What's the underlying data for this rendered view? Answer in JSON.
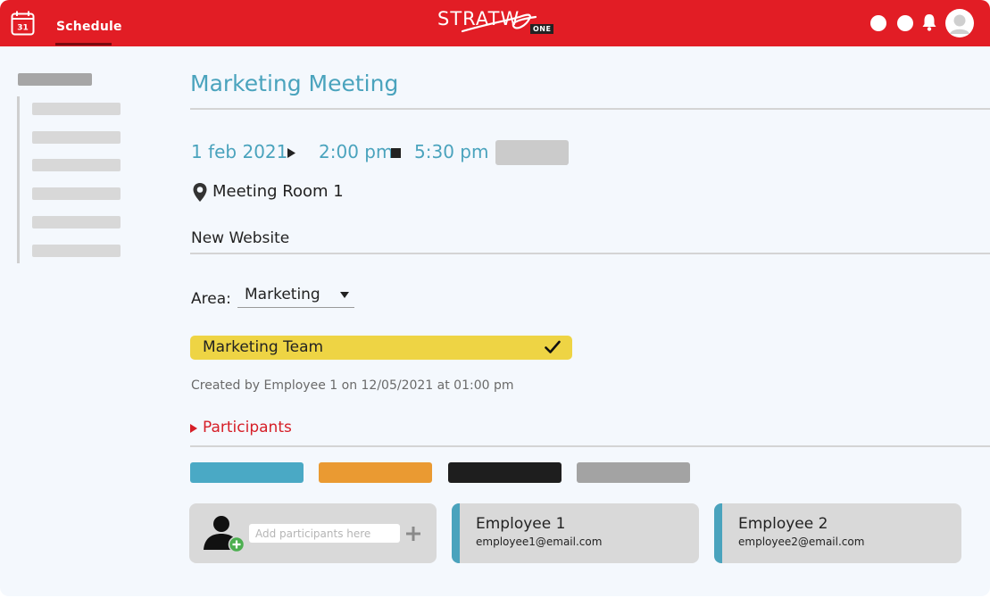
{
  "header": {
    "calendar_icon_number": "31",
    "tab_label": "Schedule",
    "logo_text": "STRATW",
    "logo_badge": "ONE",
    "brand_color": "#e21d25"
  },
  "event": {
    "title": "Marketing Meeting",
    "date": "1 feb 2021",
    "start_time": "2:00 pm",
    "end_time": "5:30 pm",
    "location": "Meeting Room 1",
    "subject": "New Website",
    "area_label": "Area:",
    "area_value": "Marketing",
    "team": "Marketing Team",
    "created_text": "Created by Employee 1 on 12/05/2021 at 01:00 pm"
  },
  "participants": {
    "section_label": "Participants",
    "filter_colors": [
      "#4aa9c5",
      "#ea9a32",
      "#1e1e1e",
      "#a3a3a3"
    ],
    "add_placeholder": "Add participants here",
    "list": [
      {
        "name": "Employee 1",
        "email": "employee1@email.com"
      },
      {
        "name": "Employee 2",
        "email": "employee2@email.com"
      }
    ]
  },
  "colors": {
    "accent": "#4aa3bd",
    "team_highlight": "#eed444",
    "participants_label": "#d61e27"
  }
}
